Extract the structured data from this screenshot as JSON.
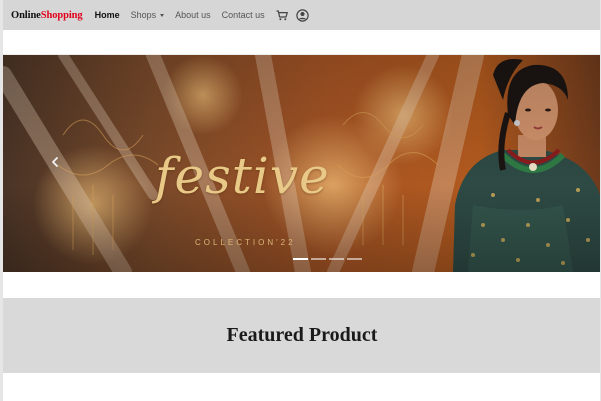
{
  "brand": {
    "part1": "Online",
    "part2": "Shopping"
  },
  "nav": {
    "home": "Home",
    "shops": "Shops",
    "about": "About us",
    "contact": "Contact us",
    "cart_icon": "cart-icon",
    "account_icon": "user-circle-icon"
  },
  "carousel": {
    "headline": "festive",
    "subline": "COLLECTION'22",
    "slides": 4,
    "active_slide": 1,
    "prev_icon": "chevron-left-icon"
  },
  "featured": {
    "title": "Featured Product"
  },
  "colors": {
    "brand_red": "#e1001a",
    "nav_bg": "#d6d6d6",
    "featured_bg": "#d9d9d9",
    "gold": "#e8c988"
  }
}
